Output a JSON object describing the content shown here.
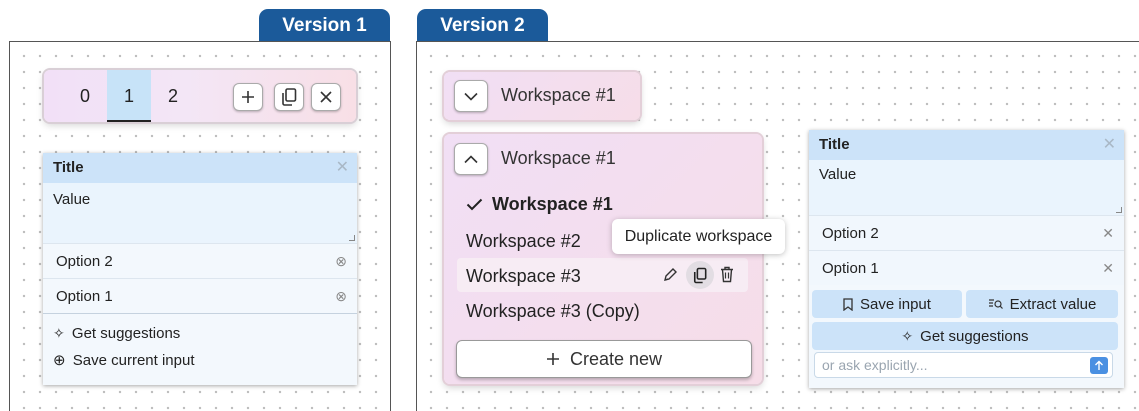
{
  "versions": {
    "v1_label": "Version 1",
    "v2_label": "Version 2"
  },
  "v1": {
    "tabs": [
      "0",
      "1",
      "2"
    ],
    "selected_tab": "1",
    "toolbar": {
      "add_icon": "plus-icon",
      "copy_icon": "copy-icon",
      "close_icon": "close-icon"
    },
    "card": {
      "title": "Title",
      "value": "Value",
      "options": [
        "Option 2",
        "Option 1"
      ],
      "suggest_label": "Get suggestions",
      "save_label": "Save current input"
    }
  },
  "v2": {
    "collapsed_workspace": "Workspace #1",
    "open_workspace": "Workspace #1",
    "workspaces": [
      "Workspace #1",
      "Workspace #2",
      "Workspace #3",
      "Workspace #3 (Copy)"
    ],
    "selected_workspace": "Workspace #1",
    "tooltip": "Duplicate workspace",
    "create_label": "Create new",
    "card": {
      "title": "Title",
      "value": "Value",
      "options": [
        "Option 2",
        "Option 1"
      ],
      "save_input_label": "Save input",
      "extract_label": "Extract value",
      "suggest_label": "Get suggestions",
      "ask_placeholder": "or ask explicitly..."
    }
  },
  "colors": {
    "tab_blue": "#1b5a9a",
    "field_title_bg": "#cce3f9",
    "selected_tab_bg": "#c7e3f8",
    "workspace_gradient_start": "#f1dff5",
    "workspace_gradient_end": "#f6dde8",
    "send_button": "#4a90e2"
  }
}
